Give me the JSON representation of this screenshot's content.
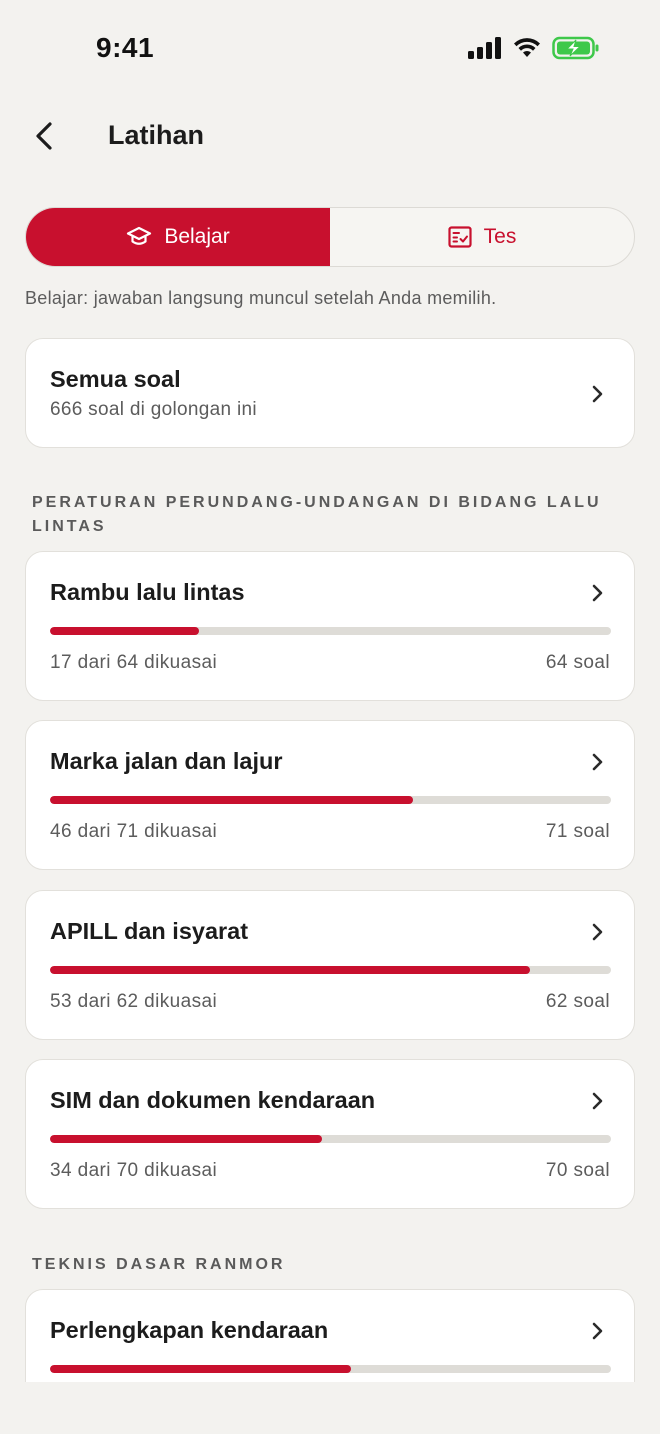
{
  "status_bar": {
    "time": "9:41"
  },
  "header": {
    "title": "Latihan"
  },
  "segments": [
    {
      "label": "Belajar",
      "icon": "graduation-cap-icon",
      "active": true
    },
    {
      "label": "Tes",
      "icon": "checklist-icon",
      "active": false
    }
  ],
  "mode_description": "Belajar: jawaban langsung muncul setelah Anda memilih.",
  "all_questions": {
    "title": "Semua soal",
    "subtitle": "666 soal di golongan ini"
  },
  "sections": [
    {
      "title": "PERATURAN PERUNDANG-UNDANGAN DI BIDANG LALU LINTAS",
      "topics": [
        {
          "title": "Rambu lalu lintas",
          "mastered_label": "17 dari 64 dikuasai",
          "count_label": "64 soal",
          "progress": 0.2656
        },
        {
          "title": "Marka jalan dan lajur",
          "mastered_label": "46 dari 71 dikuasai",
          "count_label": "71 soal",
          "progress": 0.6479
        },
        {
          "title": "APILL dan isyarat",
          "mastered_label": "53 dari 62 dikuasai",
          "count_label": "62 soal",
          "progress": 0.8548
        },
        {
          "title": "SIM dan dokumen kendaraan",
          "mastered_label": "34 dari 70 dikuasai",
          "count_label": "70 soal",
          "progress": 0.4857
        }
      ]
    },
    {
      "title": "TEKNIS DASAR RANMOR",
      "topics": [
        {
          "title": "Perlengkapan kendaraan",
          "mastered_label": "",
          "count_label": "",
          "progress": 0.536
        }
      ]
    }
  ],
  "colors": {
    "accent": "#c8102e",
    "track": "#dedcd7",
    "background": "#f3f2ef",
    "battery": "#3ec84a"
  }
}
